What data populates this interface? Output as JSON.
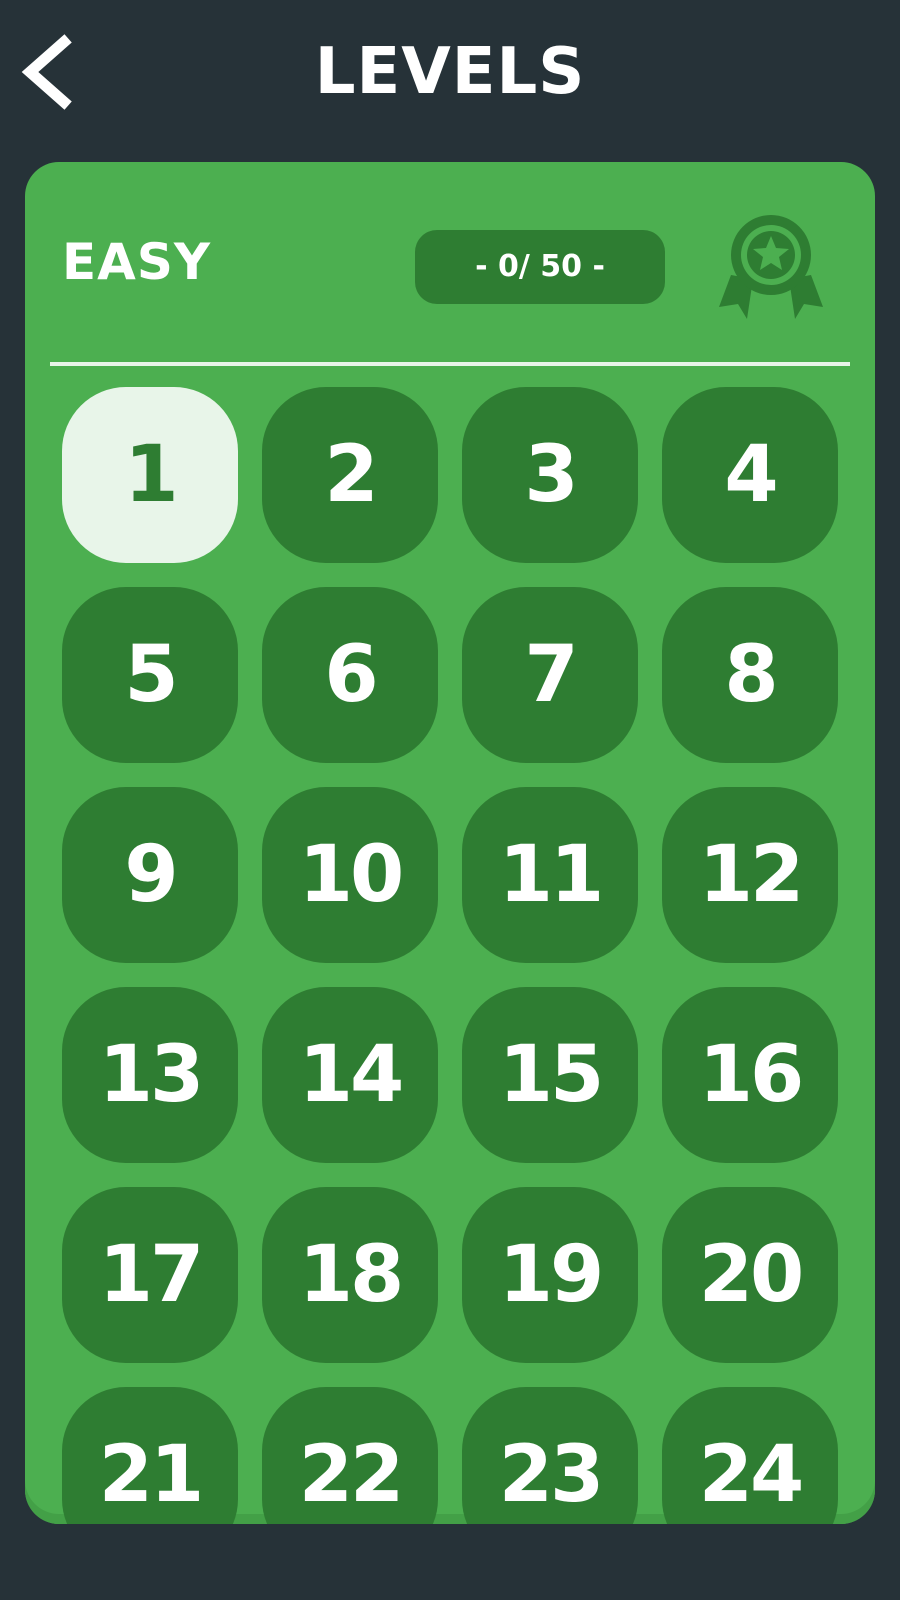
{
  "header": {
    "title": "LEVELS",
    "back_icon": "chevron-left-icon"
  },
  "panel": {
    "difficulty": "EASY",
    "progress_text": "- 0/ 50 -",
    "award_icon": "award-ribbon-star-icon",
    "levels": [
      "1",
      "2",
      "3",
      "4",
      "5",
      "6",
      "7",
      "8",
      "9",
      "10",
      "11",
      "12",
      "13",
      "14",
      "15",
      "16",
      "17",
      "18",
      "19",
      "20",
      "21",
      "22",
      "23",
      "24"
    ],
    "current_level": "1"
  },
  "colors": {
    "background": "#263238",
    "panel": "#4caf50",
    "tile": "#2e7d32",
    "tile_current": "#e8f5e9",
    "text": "#ffffff"
  }
}
